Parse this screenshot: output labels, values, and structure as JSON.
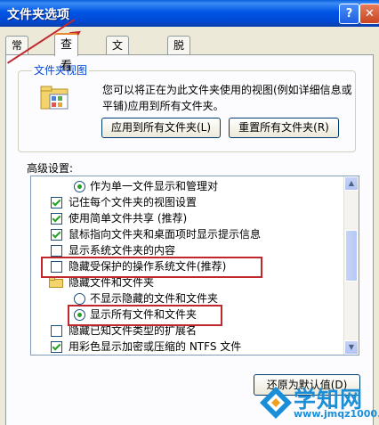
{
  "window": {
    "title": "文件夹选项",
    "help_button": "?",
    "close_button": "✕"
  },
  "tabs": [
    {
      "label": "常规"
    },
    {
      "label": "查看"
    },
    {
      "label": "文件类型"
    },
    {
      "label": "脱机文件"
    }
  ],
  "folder_views": {
    "group_label": "文件夹视图",
    "description": "您可以将正在为此文件夹使用的视图(例如详细信息或平铺)应用到所有文件夹。",
    "apply_button": "应用到所有文件夹(L)",
    "reset_button": "重置所有文件夹(R)"
  },
  "advanced": {
    "label": "高级设置:",
    "items": [
      {
        "type": "radio",
        "selected": true,
        "label": "作为单一文件显示和管理对"
      },
      {
        "type": "checkbox",
        "checked": true,
        "label": "记住每个文件夹的视图设置"
      },
      {
        "type": "checkbox",
        "checked": true,
        "label": "使用简单文件共享 (推荐)"
      },
      {
        "type": "checkbox",
        "checked": true,
        "label": "鼠标指向文件夹和桌面项时显示提示信息"
      },
      {
        "type": "checkbox",
        "checked": false,
        "label": "显示系统文件夹的内容"
      },
      {
        "type": "checkbox",
        "checked": false,
        "label": "隐藏受保护的操作系统文件(推荐)"
      },
      {
        "type": "folder",
        "label": "隐藏文件和文件夹"
      },
      {
        "type": "radio",
        "selected": false,
        "label": "不显示隐藏的文件和文件夹"
      },
      {
        "type": "radio",
        "selected": true,
        "label": "显示所有文件和文件夹"
      },
      {
        "type": "checkbox",
        "checked": false,
        "label": "隐藏已知文件类型的扩展名"
      },
      {
        "type": "checkbox",
        "checked": true,
        "label": "用彩色显示加密或压缩的 NTFS 文件"
      }
    ]
  },
  "restore_button": "还原为默认值(D)",
  "watermark": {
    "name": "学知网",
    "url": "www.jmqz1000.com"
  }
}
